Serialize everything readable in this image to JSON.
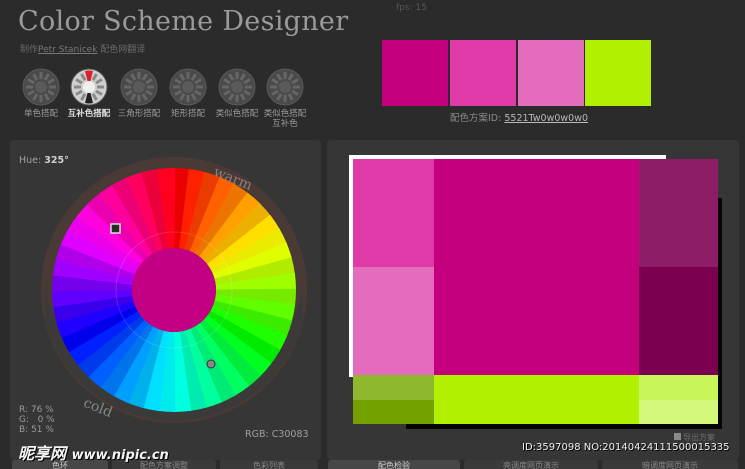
{
  "app": {
    "title": "Color Scheme Designer",
    "credit_prefix": "制作",
    "credit_author": "Petr Stanicek",
    "credit_suffix": "配色网翻译",
    "fps": "fps: 15"
  },
  "modes": [
    {
      "label": "单色搭配",
      "icon": "mono-mode-icon",
      "active": false
    },
    {
      "label": "互补色搭配",
      "icon": "complement-mode-icon",
      "active": true
    },
    {
      "label": "三角形搭配",
      "icon": "triad-mode-icon",
      "active": false
    },
    {
      "label": "矩形搭配",
      "icon": "tetrad-mode-icon",
      "active": false
    },
    {
      "label": "类似色搭配",
      "icon": "analogic-mode-icon",
      "active": false
    },
    {
      "label": "类似色搭配互补色",
      "icon": "analogic-complement-mode-icon",
      "active": false
    }
  ],
  "palette": {
    "swatches": [
      "#c4007e",
      "#e03aa8",
      "#e46cbd",
      "#b0f000"
    ],
    "id_label": "配色方案ID:",
    "id_value": "5521Tw0w0w0w0"
  },
  "wheel": {
    "hue_label": "Hue:",
    "hue_value": "325°",
    "warm": "warm",
    "cold": "cold",
    "rgb_r": "R: 76 %",
    "rgb_g": "G:   0 %",
    "rgb_b": "B: 51 %",
    "rgb_hex": "RGB: C30083",
    "center_color": "#c30083"
  },
  "preview": {
    "colors": {
      "primary": "#c4007e",
      "primary_light": "#e03aa8",
      "primary_lighter": "#e46cbd",
      "primary_dark": "#8e1d68",
      "primary_darker": "#7c0050",
      "complement": "#b0f000",
      "complement_dark": "#8fb82e",
      "complement_darker": "#74a000",
      "complement_light": "#c7f55a",
      "complement_lighter": "#d4f97a"
    },
    "export_label": "导出方案"
  },
  "tabs": {
    "left": [
      "色环",
      "配色方案调整",
      "色彩列表"
    ],
    "right": [
      "配色检验",
      "亮调度网页演示",
      "暗调度网页演示"
    ]
  },
  "watermark": {
    "logo_cn": "昵享网",
    "logo_site": "www.nipic.cn",
    "id_text": "ID:3597098 NO:20140424111500015335"
  }
}
